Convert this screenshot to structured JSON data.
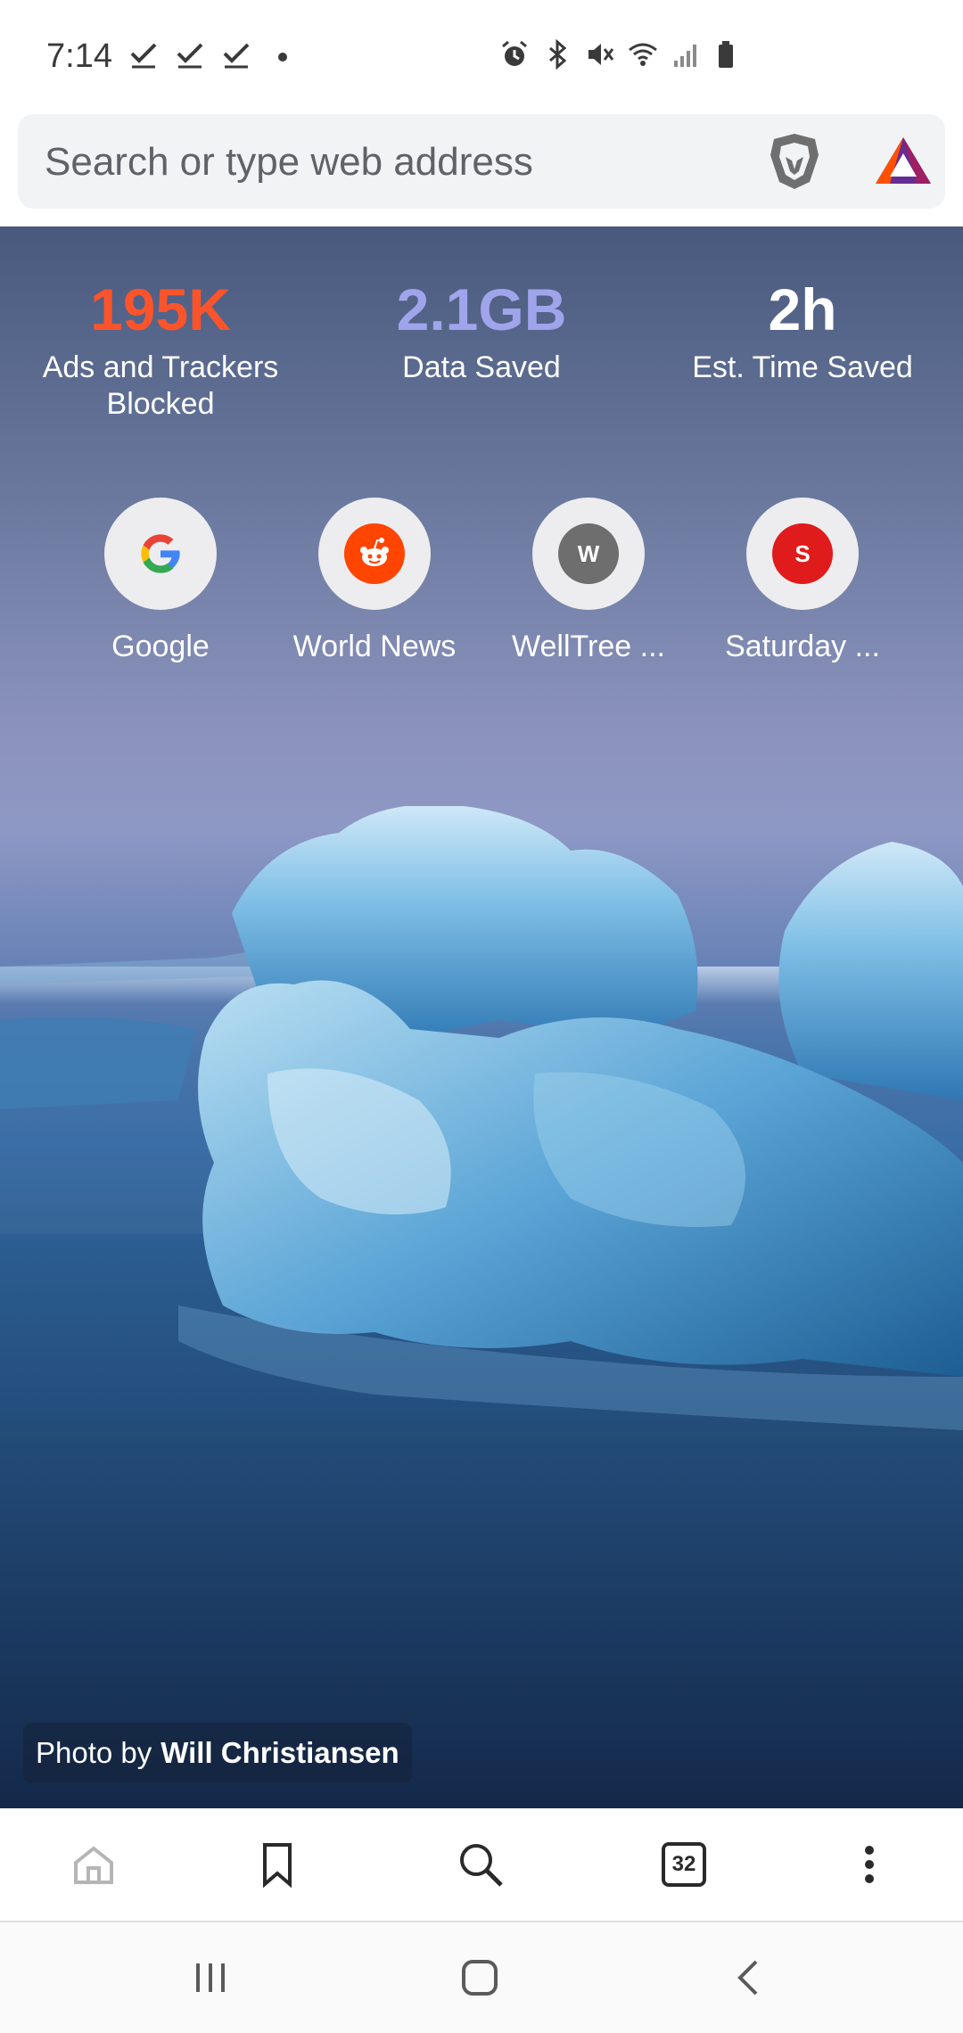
{
  "status_bar": {
    "time": "7:14",
    "left_icons": [
      "check-icon",
      "check-icon",
      "check-icon",
      "dot-icon"
    ],
    "right_icons": [
      "alarm-icon",
      "bluetooth-icon",
      "mute-icon",
      "wifi-icon",
      "signal-icon",
      "battery-icon"
    ]
  },
  "url_bar": {
    "placeholder": "Search or type web address"
  },
  "stats": [
    {
      "value": "195K",
      "label": "Ads and Trackers Blocked",
      "color": "#fb542b"
    },
    {
      "value": "2.1GB",
      "label": "Data Saved",
      "color": "#a0a5eb"
    },
    {
      "value": "2h",
      "label": "Est. Time Saved",
      "color": "#ffffff"
    }
  ],
  "top_sites": [
    {
      "label": "Google",
      "icon": "google-icon"
    },
    {
      "label": "World News",
      "icon": "reddit-icon",
      "color": "#ff4500"
    },
    {
      "label": "WellTree ...",
      "icon_letter": "W",
      "color": "#6e6e6e"
    },
    {
      "label": "Saturday ...",
      "icon_letter": "S",
      "color": "#e01b1b"
    }
  ],
  "photo_credit": {
    "prefix": "Photo by",
    "author": "Will Christiansen"
  },
  "toolbar": {
    "tab_count": "32"
  },
  "colors": {
    "accent": "#fb542b",
    "data_saved": "#a0a5eb"
  }
}
